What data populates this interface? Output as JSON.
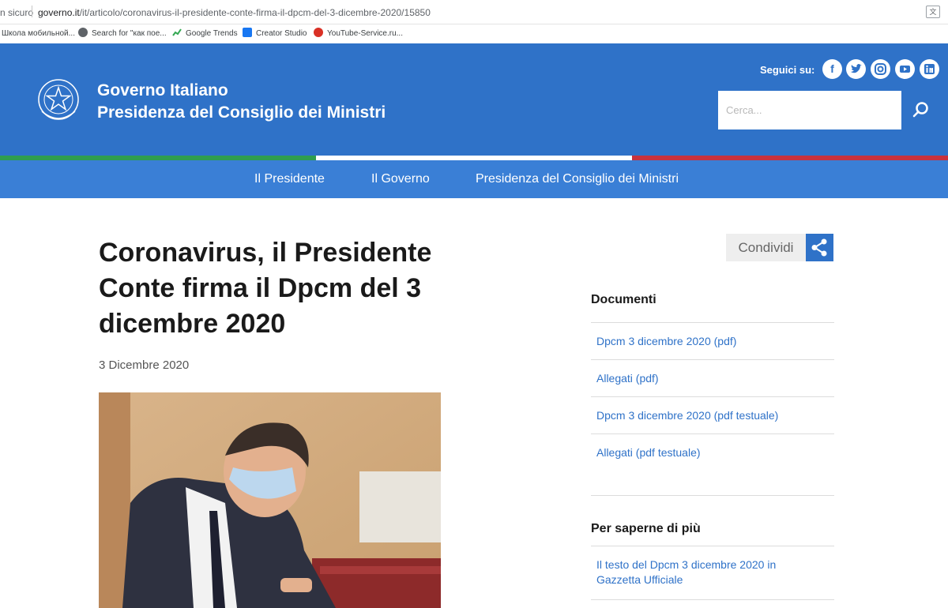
{
  "browser": {
    "status": "n sicuro",
    "url_host": "governo.it",
    "url_path": "/it/articolo/coronavirus-il-presidente-conte-firma-il-dpcm-del-3-dicembre-2020/15850",
    "bookmarks": [
      "Школа мобильной...",
      "Search for \"как пое...",
      "Google Trends",
      "Creator Studio",
      "YouTube-Service.ru..."
    ]
  },
  "header": {
    "brand_line1": "Governo Italiano",
    "brand_line2": "Presidenza del Consiglio dei Ministri",
    "follow_label": "Seguici su:",
    "social": [
      "facebook-icon",
      "twitter-icon",
      "instagram-icon",
      "youtube-icon",
      "linkedin-icon"
    ],
    "search_placeholder": "Cerca..."
  },
  "nav": {
    "items": [
      "Il Presidente",
      "Il Governo",
      "Presidenza del Consiglio dei Ministri"
    ]
  },
  "article": {
    "title": "Coronavirus, il Presidente Conte firma il Dpcm del 3 dicembre 2020",
    "date": "3 Dicembre 2020"
  },
  "sidebar": {
    "share_label": "Condividi",
    "documents_heading": "Documenti",
    "documents": [
      "Dpcm 3 dicembre 2020 (pdf)",
      "Allegati (pdf)",
      "Dpcm 3 dicembre 2020 (pdf testuale)",
      "Allegati (pdf testuale)"
    ],
    "more_heading": "Per saperne di più",
    "more_links": [
      "Il testo del Dpcm 3 dicembre 2020 in Gazzetta Ufficiale"
    ]
  },
  "colors": {
    "brand_blue": "#2f72c8",
    "nav_blue": "#3a7fd6",
    "flag_green": "#2f9d4e",
    "flag_white": "#ffffff",
    "flag_red": "#c8323c"
  }
}
